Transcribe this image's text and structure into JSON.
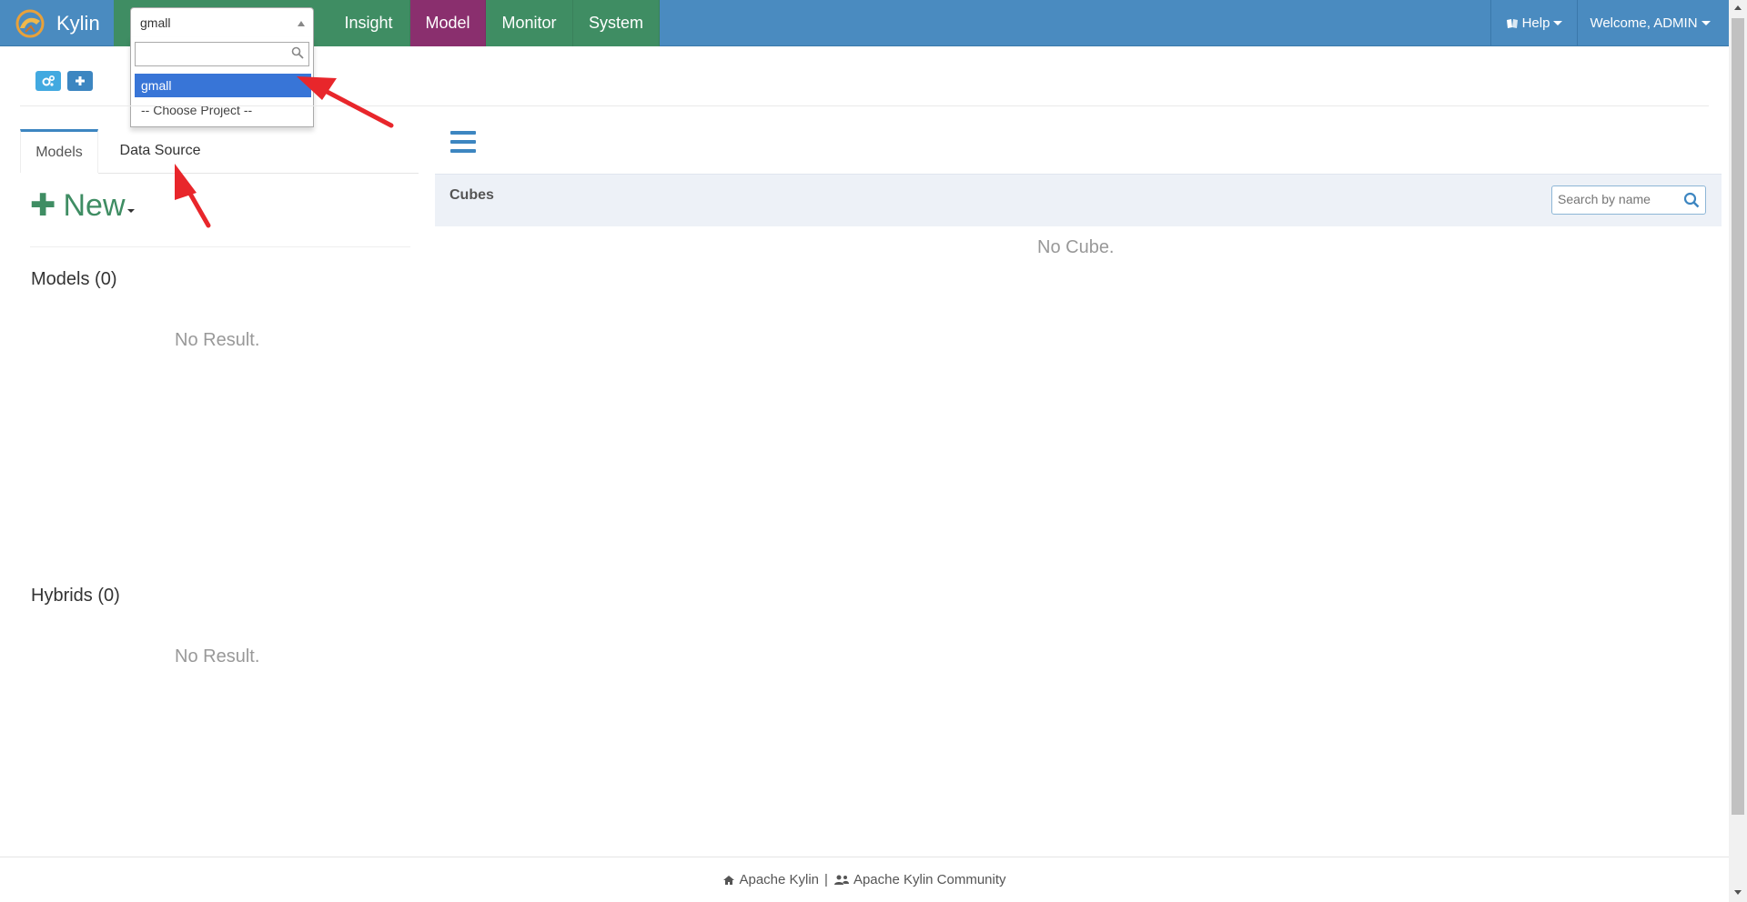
{
  "brand": {
    "name": "Kylin"
  },
  "nav": {
    "items": [
      {
        "label": "Insight"
      },
      {
        "label": "Model"
      },
      {
        "label": "Monitor"
      },
      {
        "label": "System"
      }
    ],
    "active": "Model",
    "help_label": "Help",
    "welcome_label": "Welcome, ADMIN"
  },
  "project_select": {
    "value": "gmall",
    "search_placeholder": "",
    "options": [
      {
        "label": "gmall",
        "selected": true
      },
      {
        "label": "-- Choose Project --",
        "selected": false
      }
    ]
  },
  "tabs": {
    "models": "Models",
    "data_source": "Data Source"
  },
  "left_panel": {
    "new_label": "New",
    "models_title": "Models (0)",
    "models_empty": "No Result.",
    "hybrids_title": "Hybrids (0)",
    "hybrids_empty": "No Result."
  },
  "cubes": {
    "title": "Cubes",
    "search_placeholder": "Search by name",
    "empty": "No Cube."
  },
  "footer": {
    "link1": "Apache Kylin",
    "separator": "|",
    "link2": "Apache Kylin Community"
  },
  "colors": {
    "navbar": "#4a8bc0",
    "nav_green": "#3f8d63",
    "nav_active": "#8a2f6e",
    "selected_option": "#3875d7",
    "annotation_arrow": "#e8262b"
  },
  "icons": [
    "kylin-logo-icon",
    "chevron-up-icon",
    "search-icon",
    "book-icon",
    "cogs-icon",
    "plus-icon",
    "menu-icon",
    "home-icon",
    "users-icon"
  ]
}
